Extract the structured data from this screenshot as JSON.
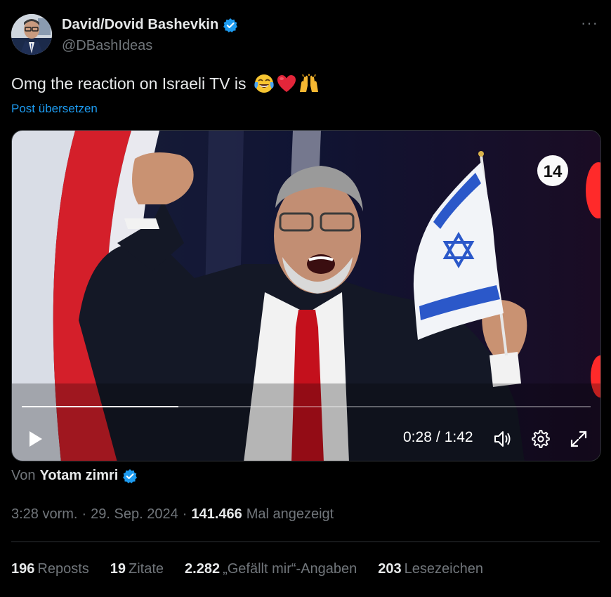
{
  "author": {
    "display_name": "David/Dovid Bashevkin",
    "handle": "@DBashIdeas",
    "verified": true
  },
  "more_menu": "···",
  "tweet": {
    "text": "Omg the reaction on Israeli TV is",
    "emojis": [
      "face-with-tears-of-joy",
      "red-heart",
      "raising-hands"
    ],
    "translate_link": "Post übersetzen"
  },
  "video": {
    "channel_badge": "14",
    "current_time": "0:28",
    "separator": "/",
    "duration": "1:42",
    "progress_fraction": 0.275,
    "controls": [
      "play-icon",
      "volume-icon",
      "settings-gear-icon",
      "fullscreen-expand-icon"
    ]
  },
  "byline": {
    "prefix": "Von",
    "author": "Yotam zimri",
    "verified": true
  },
  "meta": {
    "time": "3:28 vorm.",
    "dot1": "·",
    "date": "29. Sep. 2024",
    "dot2": "·",
    "views_count": "141.466",
    "views_label": "Mal angezeigt"
  },
  "stats": {
    "reposts_count": "196",
    "reposts_label": "Reposts",
    "quotes_count": "19",
    "quotes_label": "Zitate",
    "likes_count": "2.282",
    "likes_label": "„Gefällt mir“-Angaben",
    "bookmarks_count": "203",
    "bookmarks_label": "Lesezeichen"
  },
  "colors": {
    "background": "#000000",
    "text_primary": "#e7e9ea",
    "text_secondary": "#71767b",
    "accent_blue": "#1d9bf0",
    "divider": "#2f3336"
  }
}
